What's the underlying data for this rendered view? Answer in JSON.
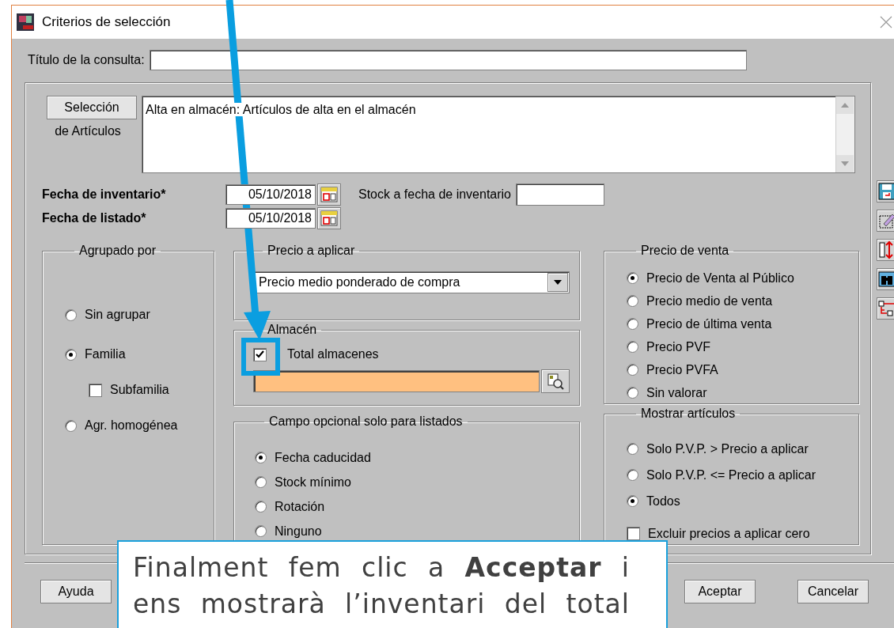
{
  "window": {
    "title": "Criterios de selección"
  },
  "query_title": {
    "label": "Título de la consulta:"
  },
  "selection": {
    "button": "Selección",
    "caption": "de Artículos",
    "criteria": "Alta en almacén: Artículos de alta en el almacén"
  },
  "dates": [
    {
      "label": "Fecha de inventario*",
      "value": "05/10/2018"
    },
    {
      "label": "Fecha de listado*",
      "value": "05/10/2018"
    }
  ],
  "stock_date": {
    "label": "Stock a fecha de inventario"
  },
  "grouping": {
    "legend": "Agrupado por",
    "options": [
      {
        "kind": "radio",
        "label": "Sin agrupar",
        "selected": false
      },
      {
        "kind": "radio",
        "label": "Familia",
        "selected": true
      },
      {
        "kind": "checkbox",
        "label": "Subfamilia",
        "checked": false
      },
      {
        "kind": "radio",
        "label": "Agr. homogénea",
        "selected": false
      }
    ]
  },
  "price_to_apply": {
    "legend": "Precio a aplicar",
    "value": "Precio medio ponderado de compra"
  },
  "warehouse": {
    "legend": "Almacén",
    "total": {
      "label": "Total almacenes",
      "checked": true
    }
  },
  "optional_field": {
    "legend": "Campo opcional solo para listados",
    "options": [
      {
        "kind": "radio",
        "label": "Fecha caducidad",
        "selected": true
      },
      {
        "kind": "radio",
        "label": "Stock mínimo",
        "selected": false
      },
      {
        "kind": "radio",
        "label": "Rotación",
        "selected": false
      },
      {
        "kind": "radio",
        "label": "Ninguno",
        "selected": false
      }
    ]
  },
  "sale_price": {
    "legend": "Precio de venta",
    "options": [
      {
        "kind": "radio",
        "label": "Precio de Venta al Público",
        "selected": true
      },
      {
        "kind": "radio",
        "label": "Precio medio de venta",
        "selected": false
      },
      {
        "kind": "radio",
        "label": "Precio de última venta",
        "selected": false
      },
      {
        "kind": "radio",
        "label": "Precio PVF",
        "selected": false
      },
      {
        "kind": "radio",
        "label": "Precio PVFA",
        "selected": false
      },
      {
        "kind": "radio",
        "label": "Sin valorar",
        "selected": false
      }
    ]
  },
  "show_items": {
    "legend": "Mostrar artículos",
    "options": [
      {
        "kind": "radio",
        "label": "Solo P.V.P. > Precio a aplicar",
        "selected": false
      },
      {
        "kind": "radio",
        "label": "Solo P.V.P. <= Precio a aplicar",
        "selected": false
      },
      {
        "kind": "radio",
        "label": "Todos",
        "selected": true
      },
      {
        "kind": "checkbox",
        "label": "Excluir precios a aplicar cero",
        "checked": false
      }
    ]
  },
  "buttons": [
    {
      "label": "Ayuda"
    },
    {
      "label": "Aceptar"
    },
    {
      "label": "Cancelar"
    }
  ],
  "callout": {
    "text": "Finalment fem clic a **Acceptar** i ens mostrarà l’inventari del total"
  }
}
